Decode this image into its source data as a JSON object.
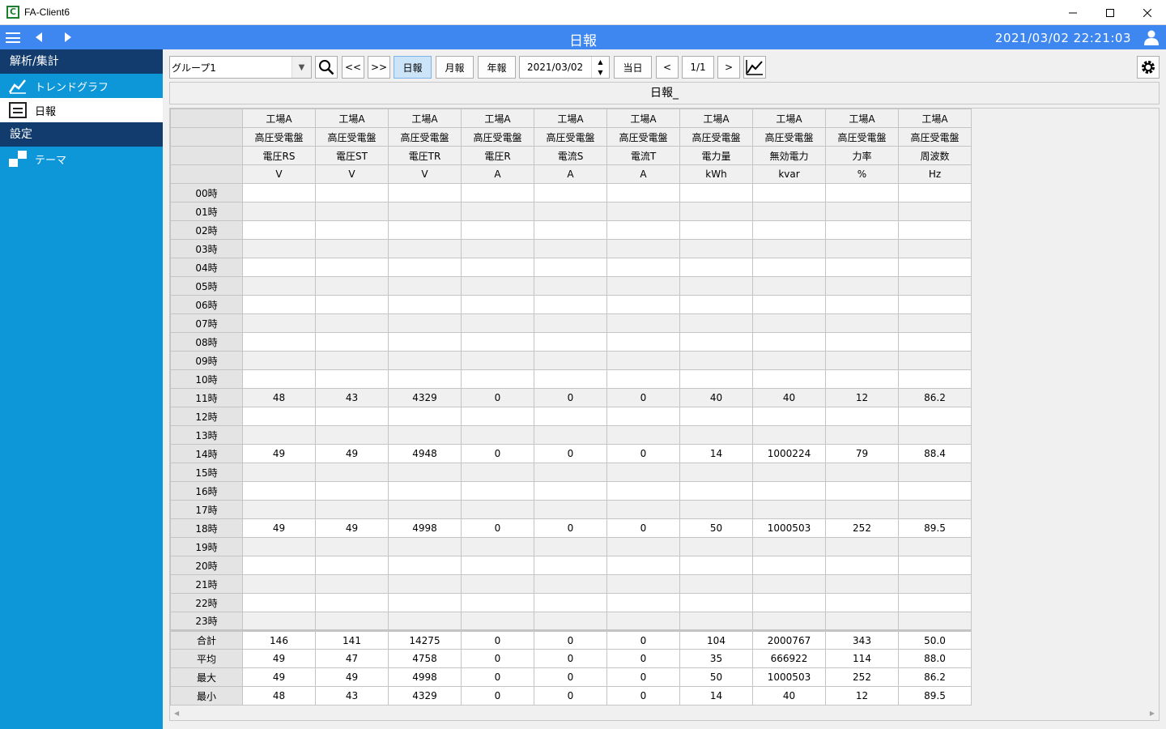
{
  "window": {
    "title": "FA-Client6",
    "icon_letter": "C"
  },
  "header": {
    "title": "日報",
    "clock": "2021/03/02 22:21:03"
  },
  "sidebar": {
    "sections": [
      {
        "label": "解析/集計",
        "items": [
          {
            "label": "トレンドグラフ",
            "icon": "trend-graph-icon",
            "active": false
          },
          {
            "label": "日報",
            "icon": "document-icon",
            "active": true
          }
        ]
      },
      {
        "label": "設定",
        "items": [
          {
            "label": "テーマ",
            "icon": "theme-icon",
            "active": false
          }
        ]
      }
    ]
  },
  "toolbar": {
    "group_value": "グループ1",
    "prev_page": "<<",
    "next_page": ">>",
    "daily": "日報",
    "monthly": "月報",
    "yearly": "年報",
    "date": "2021/03/02",
    "today": "当日",
    "prev": "<",
    "page": "1/1",
    "next": ">"
  },
  "report": {
    "title": "日報_",
    "columns": [
      {
        "site": "工場A",
        "panel": "高圧受電盤",
        "name": "電圧RS",
        "unit": "V"
      },
      {
        "site": "工場A",
        "panel": "高圧受電盤",
        "name": "電圧ST",
        "unit": "V"
      },
      {
        "site": "工場A",
        "panel": "高圧受電盤",
        "name": "電圧TR",
        "unit": "V"
      },
      {
        "site": "工場A",
        "panel": "高圧受電盤",
        "name": "電圧R",
        "unit": "A"
      },
      {
        "site": "工場A",
        "panel": "高圧受電盤",
        "name": "電流S",
        "unit": "A"
      },
      {
        "site": "工場A",
        "panel": "高圧受電盤",
        "name": "電流T",
        "unit": "A"
      },
      {
        "site": "工場A",
        "panel": "高圧受電盤",
        "name": "電力量",
        "unit": "kWh"
      },
      {
        "site": "工場A",
        "panel": "高圧受電盤",
        "name": "無効電力",
        "unit": "kvar"
      },
      {
        "site": "工場A",
        "panel": "高圧受電盤",
        "name": "力率",
        "unit": "%"
      },
      {
        "site": "工場A",
        "panel": "高圧受電盤",
        "name": "周波数",
        "unit": "Hz"
      }
    ],
    "rows": [
      {
        "label": "00時",
        "values": [
          "",
          "",
          "",
          "",
          "",
          "",
          "",
          "",
          "",
          ""
        ]
      },
      {
        "label": "01時",
        "values": [
          "",
          "",
          "",
          "",
          "",
          "",
          "",
          "",
          "",
          ""
        ]
      },
      {
        "label": "02時",
        "values": [
          "",
          "",
          "",
          "",
          "",
          "",
          "",
          "",
          "",
          ""
        ]
      },
      {
        "label": "03時",
        "values": [
          "",
          "",
          "",
          "",
          "",
          "",
          "",
          "",
          "",
          ""
        ]
      },
      {
        "label": "04時",
        "values": [
          "",
          "",
          "",
          "",
          "",
          "",
          "",
          "",
          "",
          ""
        ]
      },
      {
        "label": "05時",
        "values": [
          "",
          "",
          "",
          "",
          "",
          "",
          "",
          "",
          "",
          ""
        ]
      },
      {
        "label": "06時",
        "values": [
          "",
          "",
          "",
          "",
          "",
          "",
          "",
          "",
          "",
          ""
        ]
      },
      {
        "label": "07時",
        "values": [
          "",
          "",
          "",
          "",
          "",
          "",
          "",
          "",
          "",
          ""
        ]
      },
      {
        "label": "08時",
        "values": [
          "",
          "",
          "",
          "",
          "",
          "",
          "",
          "",
          "",
          ""
        ]
      },
      {
        "label": "09時",
        "values": [
          "",
          "",
          "",
          "",
          "",
          "",
          "",
          "",
          "",
          ""
        ]
      },
      {
        "label": "10時",
        "values": [
          "",
          "",
          "",
          "",
          "",
          "",
          "",
          "",
          "",
          ""
        ]
      },
      {
        "label": "11時",
        "values": [
          "48",
          "43",
          "4329",
          "0",
          "0",
          "0",
          "40",
          "40",
          "12",
          "86.2"
        ]
      },
      {
        "label": "12時",
        "values": [
          "",
          "",
          "",
          "",
          "",
          "",
          "",
          "",
          "",
          ""
        ]
      },
      {
        "label": "13時",
        "values": [
          "",
          "",
          "",
          "",
          "",
          "",
          "",
          "",
          "",
          ""
        ]
      },
      {
        "label": "14時",
        "values": [
          "49",
          "49",
          "4948",
          "0",
          "0",
          "0",
          "14",
          "1000224",
          "79",
          "88.4"
        ]
      },
      {
        "label": "15時",
        "values": [
          "",
          "",
          "",
          "",
          "",
          "",
          "",
          "",
          "",
          ""
        ]
      },
      {
        "label": "16時",
        "values": [
          "",
          "",
          "",
          "",
          "",
          "",
          "",
          "",
          "",
          ""
        ]
      },
      {
        "label": "17時",
        "values": [
          "",
          "",
          "",
          "",
          "",
          "",
          "",
          "",
          "",
          ""
        ]
      },
      {
        "label": "18時",
        "values": [
          "49",
          "49",
          "4998",
          "0",
          "0",
          "0",
          "50",
          "1000503",
          "252",
          "89.5"
        ]
      },
      {
        "label": "19時",
        "values": [
          "",
          "",
          "",
          "",
          "",
          "",
          "",
          "",
          "",
          ""
        ]
      },
      {
        "label": "20時",
        "values": [
          "",
          "",
          "",
          "",
          "",
          "",
          "",
          "",
          "",
          ""
        ]
      },
      {
        "label": "21時",
        "values": [
          "",
          "",
          "",
          "",
          "",
          "",
          "",
          "",
          "",
          ""
        ]
      },
      {
        "label": "22時",
        "values": [
          "",
          "",
          "",
          "",
          "",
          "",
          "",
          "",
          "",
          ""
        ]
      },
      {
        "label": "23時",
        "values": [
          "",
          "",
          "",
          "",
          "",
          "",
          "",
          "",
          "",
          ""
        ]
      }
    ],
    "summary": [
      {
        "label": "合計",
        "values": [
          "146",
          "141",
          "14275",
          "0",
          "0",
          "0",
          "104",
          "2000767",
          "343",
          "50.0"
        ]
      },
      {
        "label": "平均",
        "values": [
          "49",
          "47",
          "4758",
          "0",
          "0",
          "0",
          "35",
          "666922",
          "114",
          "88.0"
        ]
      },
      {
        "label": "最大",
        "values": [
          "49",
          "49",
          "4998",
          "0",
          "0",
          "0",
          "50",
          "1000503",
          "252",
          "86.2"
        ]
      },
      {
        "label": "最小",
        "values": [
          "48",
          "43",
          "4329",
          "0",
          "0",
          "0",
          "14",
          "40",
          "12",
          "89.5"
        ]
      }
    ]
  },
  "colors": {
    "header": "#3f87f0",
    "sidebar": "#0d97d8",
    "section": "#133c6e",
    "selected": "#cce4f7"
  }
}
